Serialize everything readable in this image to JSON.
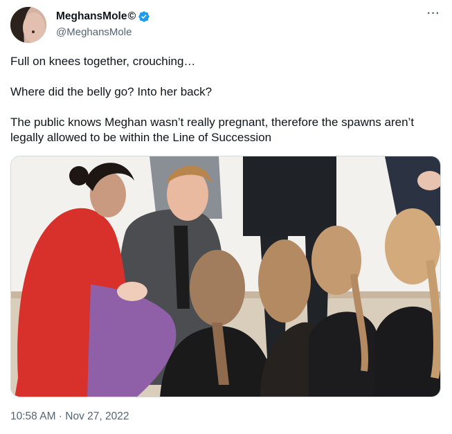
{
  "author": {
    "display_name": "MeghansMole",
    "copyright_mark": "©",
    "handle": "@MeghansMole",
    "verified": true,
    "verified_color": "#1d9bf0",
    "avatar_icon": "profile-photo"
  },
  "more_label": "···",
  "tweet": {
    "paragraphs": [
      "Full on knees together, crouching…",
      "Where did the belly go? Into her back?",
      "The public knows Meghan wasn’t really pregnant, therefore the spawns aren’t legally allowed to be within the Line of Succession"
    ]
  },
  "media": {
    "type": "photo",
    "accent_colors": {
      "red_coat": "#d8312b",
      "purple_skirt": "#8f5fa8",
      "grey_jacket": "#4b4d50"
    }
  },
  "timestamp": "10:58 AM · Nov 27, 2022"
}
